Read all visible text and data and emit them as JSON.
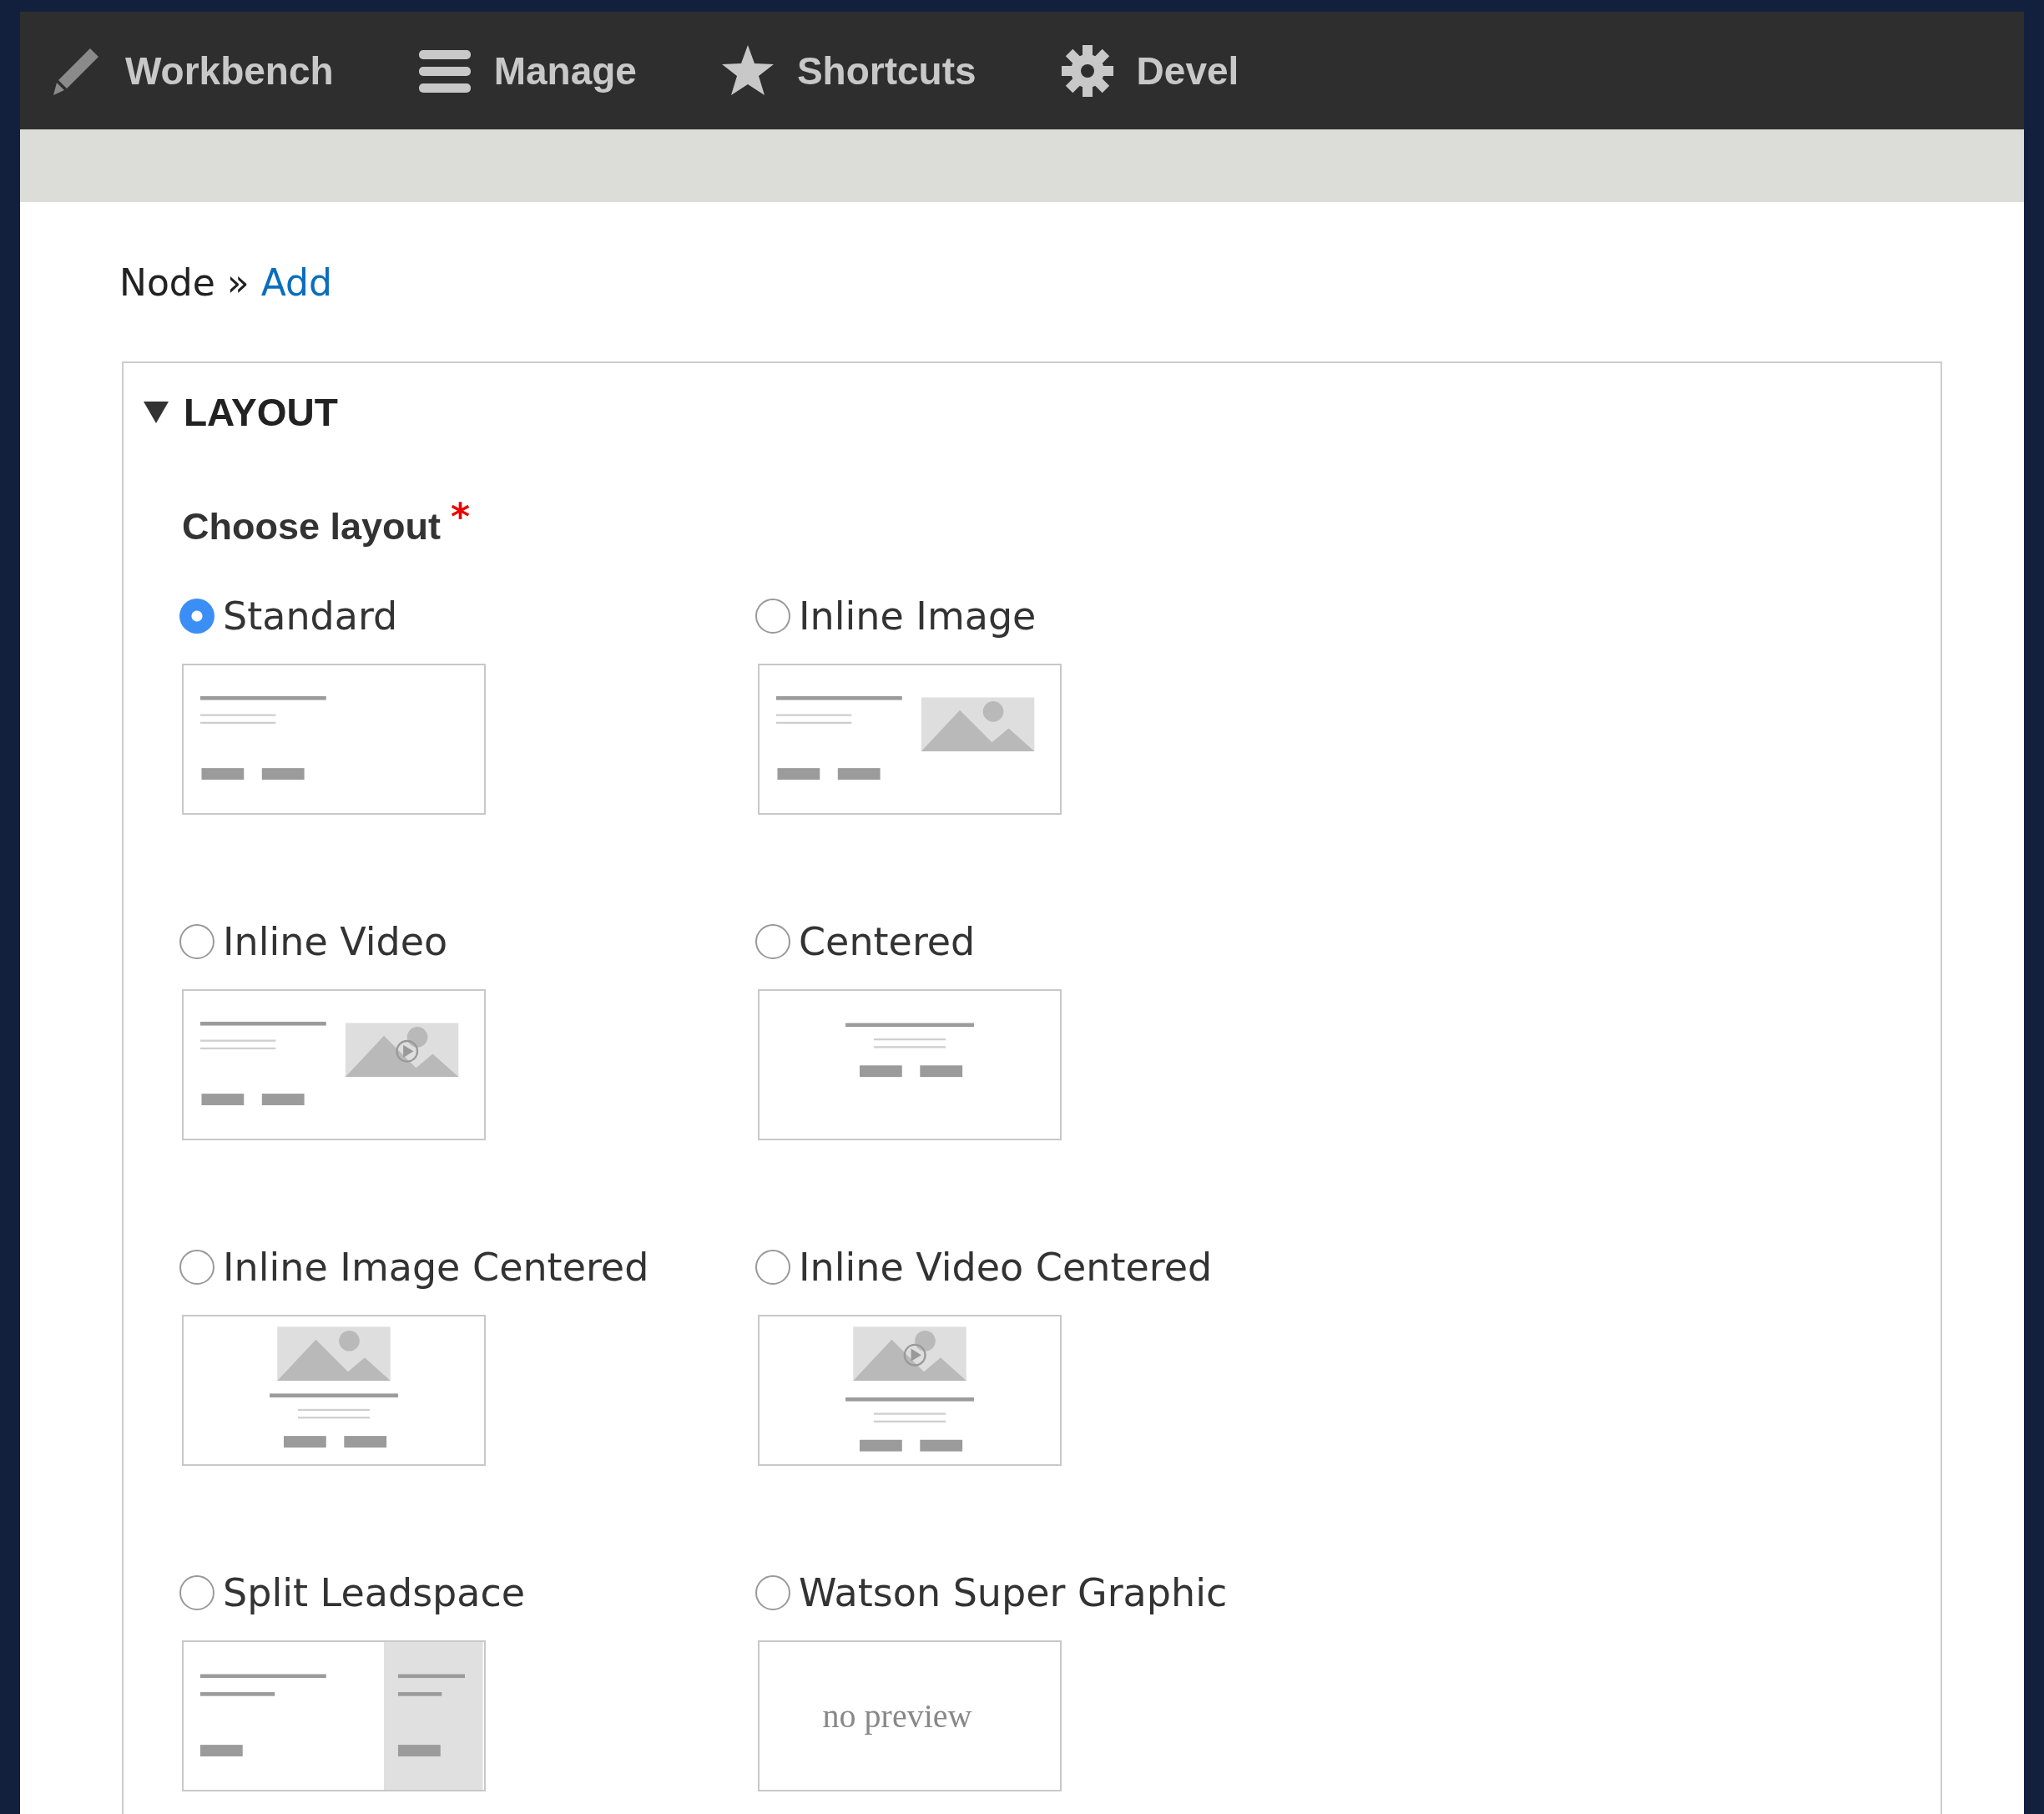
{
  "toolbar": {
    "items": [
      {
        "label": "Workbench",
        "kind": "pencil"
      },
      {
        "label": "Manage",
        "kind": "menu"
      },
      {
        "label": "Shortcuts",
        "kind": "star"
      },
      {
        "label": "Devel",
        "kind": "gear"
      }
    ]
  },
  "breadcrumb": {
    "separator": "»",
    "items": [
      {
        "label": "Node",
        "link": false
      },
      {
        "label": "Add",
        "link": true
      }
    ]
  },
  "fieldset": {
    "title": "LAYOUT",
    "expanded": true,
    "field": {
      "label": "Choose layout",
      "required": true,
      "required_mark": "*"
    },
    "options": [
      {
        "label": "Standard",
        "selected": true,
        "kind": "standard"
      },
      {
        "label": "Inline Image",
        "selected": false,
        "kind": "inline"
      },
      {
        "label": "Inline Video",
        "selected": false,
        "kind": "video"
      },
      {
        "label": "Centered",
        "selected": false,
        "kind": "centered"
      },
      {
        "label": "Inline Image Centered",
        "selected": false,
        "kind": "imagecentered"
      },
      {
        "label": "Inline Video Centered",
        "selected": false,
        "kind": "videocentered"
      },
      {
        "label": "Split Leadspace",
        "selected": false,
        "kind": "split"
      },
      {
        "label": "Watson Super Graphic",
        "selected": false,
        "kind": "none",
        "preview_text": "no preview"
      }
    ]
  }
}
